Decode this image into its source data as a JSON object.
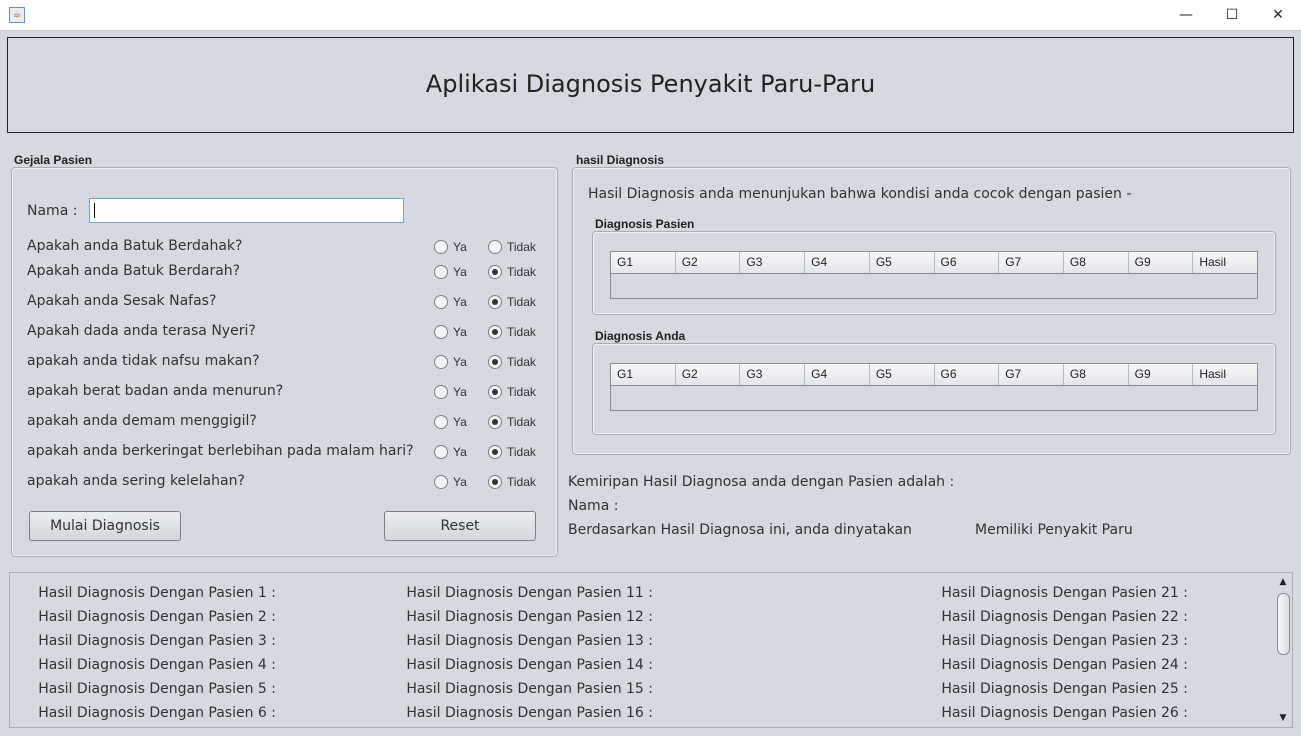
{
  "window": {
    "app_icon": "java-cup-icon",
    "controls": {
      "minimize": "—",
      "maximize": "☐",
      "close": "✕"
    }
  },
  "header": {
    "title": "Aplikasi Diagnosis Penyakit Paru-Paru"
  },
  "gejala": {
    "section_label": "Gejala Pasien",
    "nama_label": "Nama :",
    "nama_value": "",
    "option_ya": "Ya",
    "option_tidak": "Tidak",
    "questions": [
      {
        "text": "Apakah anda Batuk Berdahak?",
        "selected": "none"
      },
      {
        "text": "Apakah anda Batuk Berdarah?",
        "selected": "tidak"
      },
      {
        "text": "Apakah anda Sesak Nafas?",
        "selected": "tidak"
      },
      {
        "text": "Apakah dada anda terasa Nyeri?",
        "selected": "tidak"
      },
      {
        "text": "apakah anda tidak nafsu makan?",
        "selected": "tidak"
      },
      {
        "text": "apakah berat badan anda menurun?",
        "selected": "tidak"
      },
      {
        "text": "apakah anda demam menggigil?",
        "selected": "tidak"
      },
      {
        "text": "apakah anda berkeringat berlebihan pada malam hari?",
        "selected": "tidak"
      },
      {
        "text": "apakah anda sering kelelahan?",
        "selected": "tidak"
      }
    ],
    "mulai_button": "Mulai Diagnosis",
    "reset_button": "Reset"
  },
  "hasil": {
    "section_label": "hasil Diagnosis",
    "intro_text": "Hasil Diagnosis anda menunjukan bahwa kondisi anda cocok dengan pasien -",
    "pasien_table": {
      "label": "Diagnosis Pasien",
      "columns": [
        "G1",
        "G2",
        "G3",
        "G4",
        "G5",
        "G6",
        "G7",
        "G8",
        "G9",
        "Hasil"
      ]
    },
    "anda_table": {
      "label": "Diagnosis Anda",
      "columns": [
        "G1",
        "G2",
        "G3",
        "G4",
        "G5",
        "G6",
        "G7",
        "G8",
        "G9",
        "Hasil"
      ]
    },
    "kemiripan_text": "Kemiripan Hasil Diagnosa anda dengan Pasien adalah :",
    "nama_text": "Nama :",
    "berdasarkan_text": "Berdasarkan Hasil Diagnosa ini, anda dinyatakan",
    "result_text": "Memiliki Penyakit Paru"
  },
  "pasien_list": {
    "col1": [
      "Hasil Diagnosis Dengan Pasien 1 :",
      "Hasil Diagnosis Dengan Pasien 2 :",
      "Hasil Diagnosis Dengan Pasien 3 :",
      "Hasil Diagnosis Dengan Pasien 4 :",
      "Hasil Diagnosis Dengan Pasien 5 :",
      "Hasil Diagnosis Dengan Pasien 6 :"
    ],
    "col2": [
      "Hasil Diagnosis Dengan Pasien 11 :",
      "Hasil Diagnosis Dengan Pasien 12 :",
      "Hasil Diagnosis Dengan Pasien 13 :",
      "Hasil Diagnosis Dengan Pasien 14 :",
      "Hasil Diagnosis Dengan Pasien 15 :",
      "Hasil Diagnosis Dengan Pasien 16 :"
    ],
    "col3": [
      "Hasil Diagnosis Dengan Pasien 21 :",
      "Hasil Diagnosis Dengan Pasien 22 :",
      "Hasil Diagnosis Dengan Pasien 23 :",
      "Hasil Diagnosis Dengan Pasien 24 :",
      "Hasil Diagnosis Dengan Pasien 25 :",
      "Hasil Diagnosis Dengan Pasien 26 :"
    ]
  }
}
